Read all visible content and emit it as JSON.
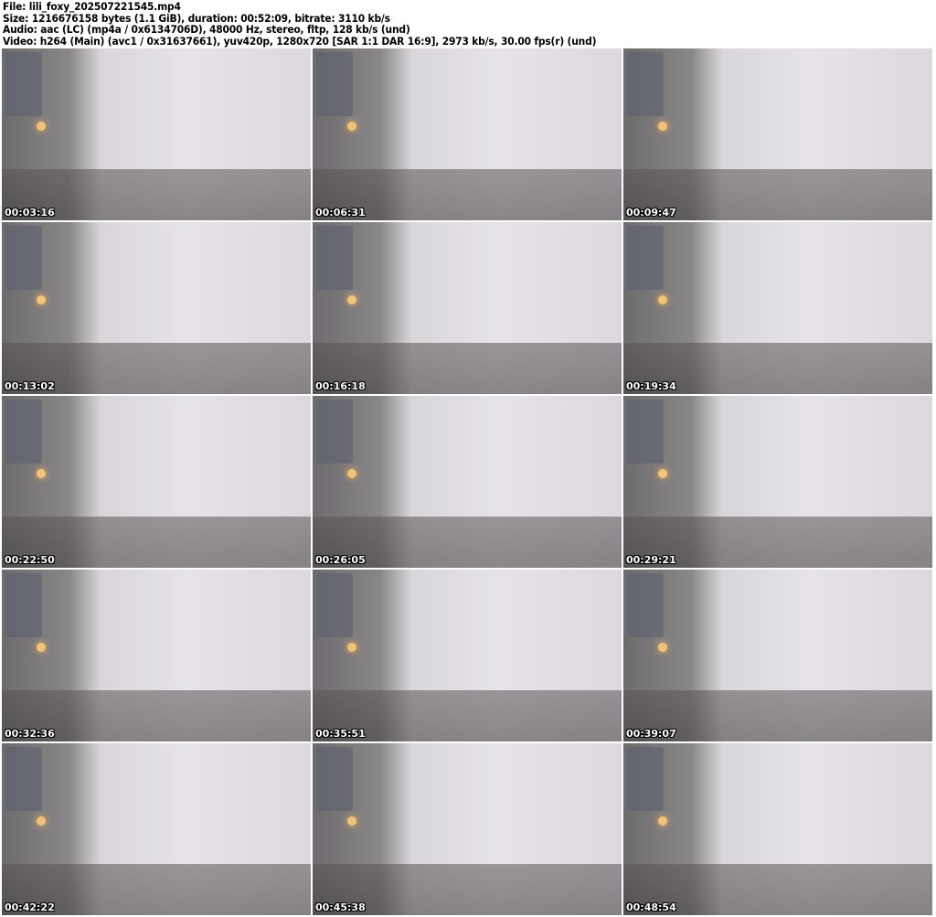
{
  "header": {
    "file": "File: lili_foxy_202507221545.mp4",
    "size": "Size: 1216676158 bytes (1.1 GiB), duration: 00:52:09, bitrate: 3110 kb/s",
    "audio": "Audio: aac (LC) (mp4a / 0x6134706D), 48000 Hz, stereo, fltp, 128 kb/s (und)",
    "video": "Video: h264 (Main) (avc1 / 0x31637661), yuv420p, 1280x720 [SAR 1:1 DAR 16:9], 2973 kb/s, 30.00 fps(r) (und)"
  },
  "thumbnails": [
    "00:03:16",
    "00:06:31",
    "00:09:47",
    "00:13:02",
    "00:16:18",
    "00:19:34",
    "00:22:50",
    "00:26:05",
    "00:29:21",
    "00:32:36",
    "00:35:51",
    "00:39:07",
    "00:42:22",
    "00:45:38",
    "00:48:54"
  ]
}
